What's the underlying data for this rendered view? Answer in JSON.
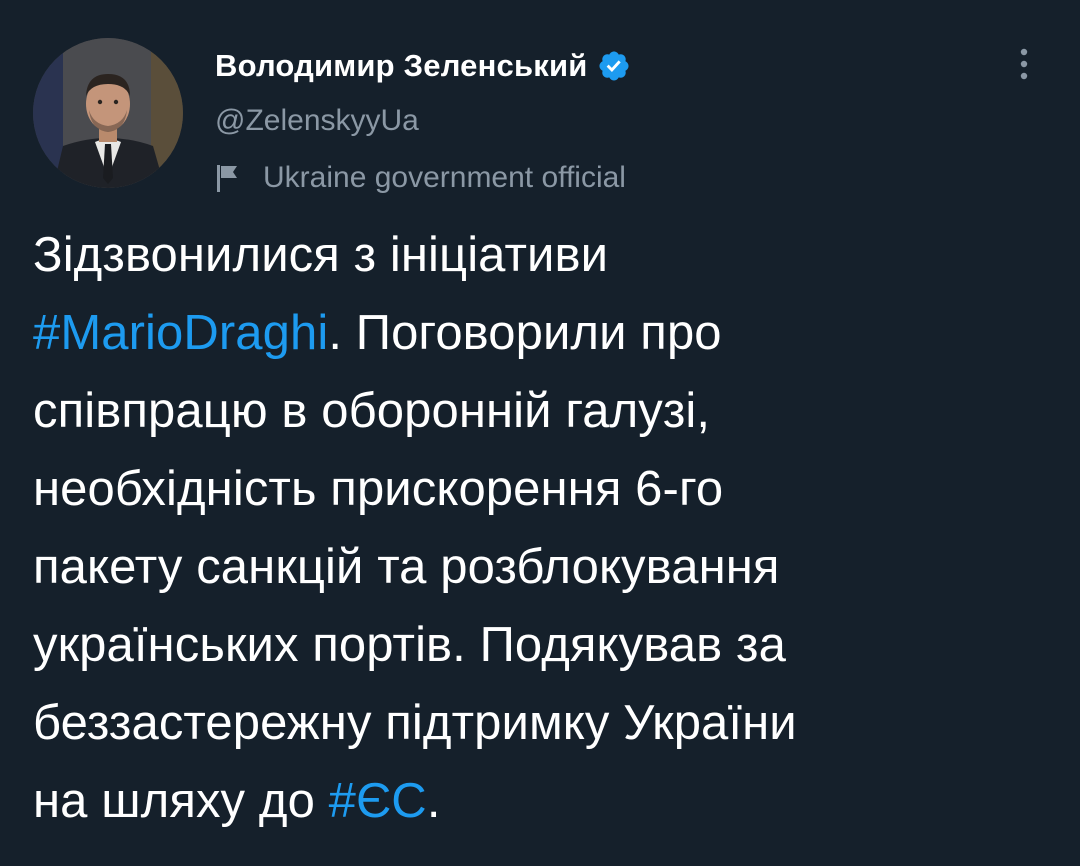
{
  "author": {
    "display_name": "Володимир Зеленський",
    "handle": "@ZelenskyyUa",
    "label": "Ukraine government official",
    "verified": true,
    "avatar_icon": "profile-photo",
    "verified_icon": "verified-badge-icon",
    "label_icon": "flag-icon"
  },
  "menu": {
    "icon": "more-options-icon"
  },
  "tweet": {
    "lines": [
      [
        {
          "text": "Зідзвонилися з ініціативи"
        }
      ],
      [
        {
          "text": "#MarioDraghi",
          "hashtag": true
        },
        {
          "text": ". Поговорили про"
        }
      ],
      [
        {
          "text": "співпрацю в оборонній галузі,"
        }
      ],
      [
        {
          "text": "необхідність прискорення 6-го"
        }
      ],
      [
        {
          "text": "пакету санкцій та розблокування"
        }
      ],
      [
        {
          "text": "українських портів. Подякував за"
        }
      ],
      [
        {
          "text": "беззастережну підтримку України"
        }
      ],
      [
        {
          "text": "на шляху до "
        },
        {
          "text": "#ЄС",
          "hashtag": true
        },
        {
          "text": "."
        }
      ]
    ]
  },
  "colors": {
    "background": "#15202b",
    "text": "#ffffff",
    "secondary": "#8b98a5",
    "accent": "#1d9bf0"
  }
}
